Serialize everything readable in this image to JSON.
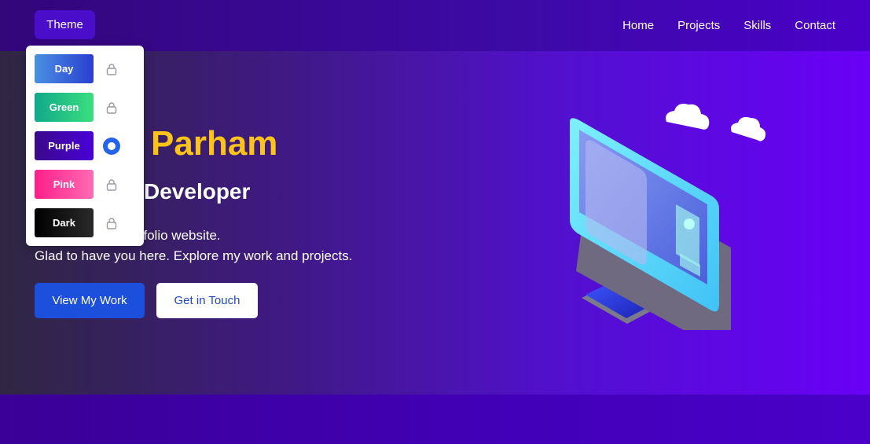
{
  "nav": {
    "theme_label": "Theme",
    "links": [
      "Home",
      "Projects",
      "Skills",
      "Contact"
    ]
  },
  "hero": {
    "name": "Parham",
    "role": "Developer",
    "desc_line1": "rtfolio website.",
    "desc_line2": "Glad to have you here. Explore my work and projects.",
    "primary_btn": "View My Work",
    "secondary_btn": "Get in Touch"
  },
  "theme_menu": {
    "options": [
      {
        "label": "Day",
        "state": "locked",
        "gradient": [
          "#4a90e2",
          "#2a3fd1"
        ]
      },
      {
        "label": "Green",
        "state": "locked",
        "gradient": [
          "#11a88a",
          "#3adf7e"
        ]
      },
      {
        "label": "Purple",
        "state": "selected",
        "gradient": [
          "#3a0a8a",
          "#4a00d8"
        ]
      },
      {
        "label": "Pink",
        "state": "locked",
        "gradient": [
          "#ff1f8a",
          "#ff6ab3"
        ]
      },
      {
        "label": "Dark",
        "state": "locked",
        "gradient": [
          "#000000",
          "#2a2a2a"
        ]
      }
    ]
  },
  "colors": {
    "accent_yellow": "#fcc419",
    "primary_blue": "#1c4fdc",
    "radio_blue": "#2563eb"
  },
  "icons": {
    "locked": "lock-icon",
    "selected": "radio-selected-icon"
  }
}
